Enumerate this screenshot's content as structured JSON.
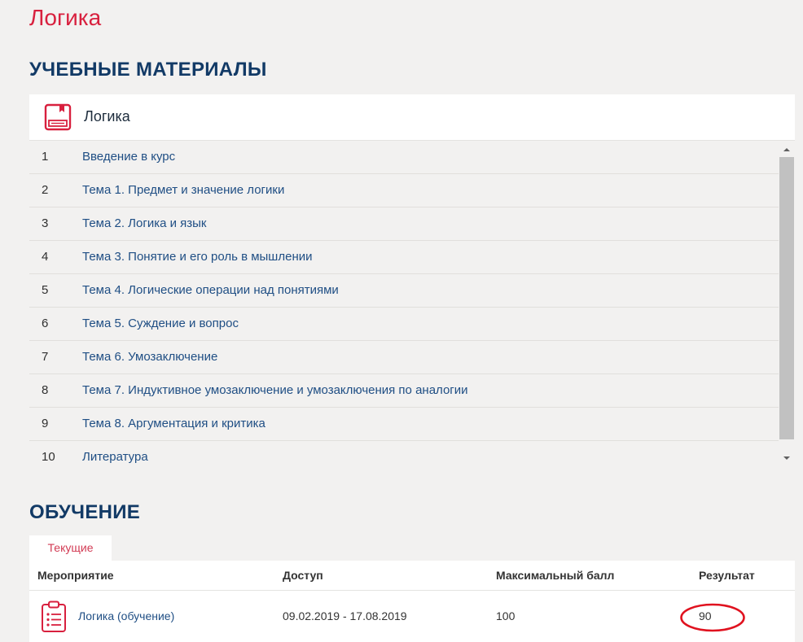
{
  "page": {
    "title": "Логика"
  },
  "materials": {
    "heading": "УЧЕБНЫЕ МАТЕРИАЛЫ",
    "card_title": "Логика",
    "topics": [
      {
        "num": "1",
        "label": "Введение в курс"
      },
      {
        "num": "2",
        "label": "Тема 1. Предмет и значение логики"
      },
      {
        "num": "3",
        "label": "Тема 2. Логика и язык"
      },
      {
        "num": "4",
        "label": "Тема 3. Понятие и его роль в мышлении"
      },
      {
        "num": "5",
        "label": "Тема 4. Логические операции над понятиями"
      },
      {
        "num": "6",
        "label": "Тема 5. Суждение и вопрос"
      },
      {
        "num": "7",
        "label": "Тема 6. Умозаключение"
      },
      {
        "num": "8",
        "label": "Тема 7. Индуктивное умозаключение и умозаключения по аналогии"
      },
      {
        "num": "9",
        "label": "Тема 8. Аргументация и критика"
      },
      {
        "num": "10",
        "label": "Литература"
      }
    ]
  },
  "learning": {
    "heading": "ОБУЧЕНИЕ",
    "tab_current": "Текущие",
    "columns": {
      "event": "Мероприятие",
      "access": "Доступ",
      "max_score": "Максимальный балл",
      "result": "Результат"
    },
    "rows": [
      {
        "event": "Логика (обучение)",
        "access": "09.02.2019 - 17.08.2019",
        "max_score": "100",
        "result": "90"
      }
    ]
  },
  "colors": {
    "accent": "#d8203e",
    "heading": "#123a66",
    "link": "#1f4e84",
    "annotation": "#e0121f"
  },
  "icons": {
    "card_icon": "book-icon",
    "event_icon": "clipboard-list-icon"
  }
}
